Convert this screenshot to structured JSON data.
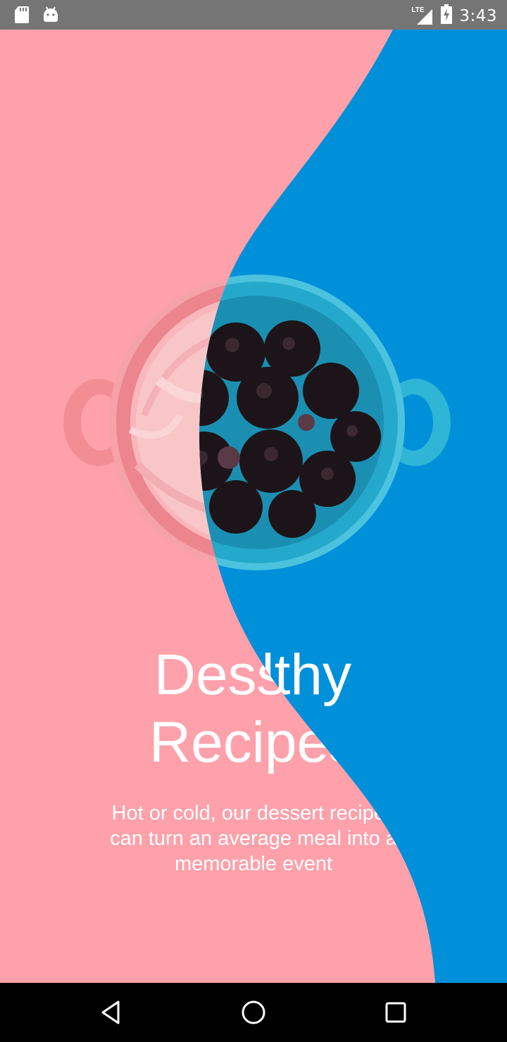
{
  "status_bar": {
    "time": "3:43",
    "network": "LTE",
    "icons": [
      "sd-card-icon",
      "android-debug-icon",
      "lte-signal-icon",
      "battery-charging-icon"
    ]
  },
  "onboarding": {
    "left_page": {
      "title": "Dessert Recipes",
      "title_line1": "Dessert",
      "title_line2": "Recipes",
      "description": "Hot or cold, our dessert recipes can turn an average meal into a memorable event",
      "background_color": "#fea1ab",
      "bowl_color": "#f38d94",
      "image": "ice-cream-bowl"
    },
    "right_page": {
      "title": "Healthy",
      "title_line1": "Healthy",
      "title_line2": "",
      "description": "",
      "background_color": "#0090da",
      "bowl_color": "#2fb6d6",
      "image": "blackberries-bowl"
    }
  },
  "nav_bar": {
    "buttons": [
      "back-icon",
      "home-icon",
      "recents-icon"
    ]
  }
}
